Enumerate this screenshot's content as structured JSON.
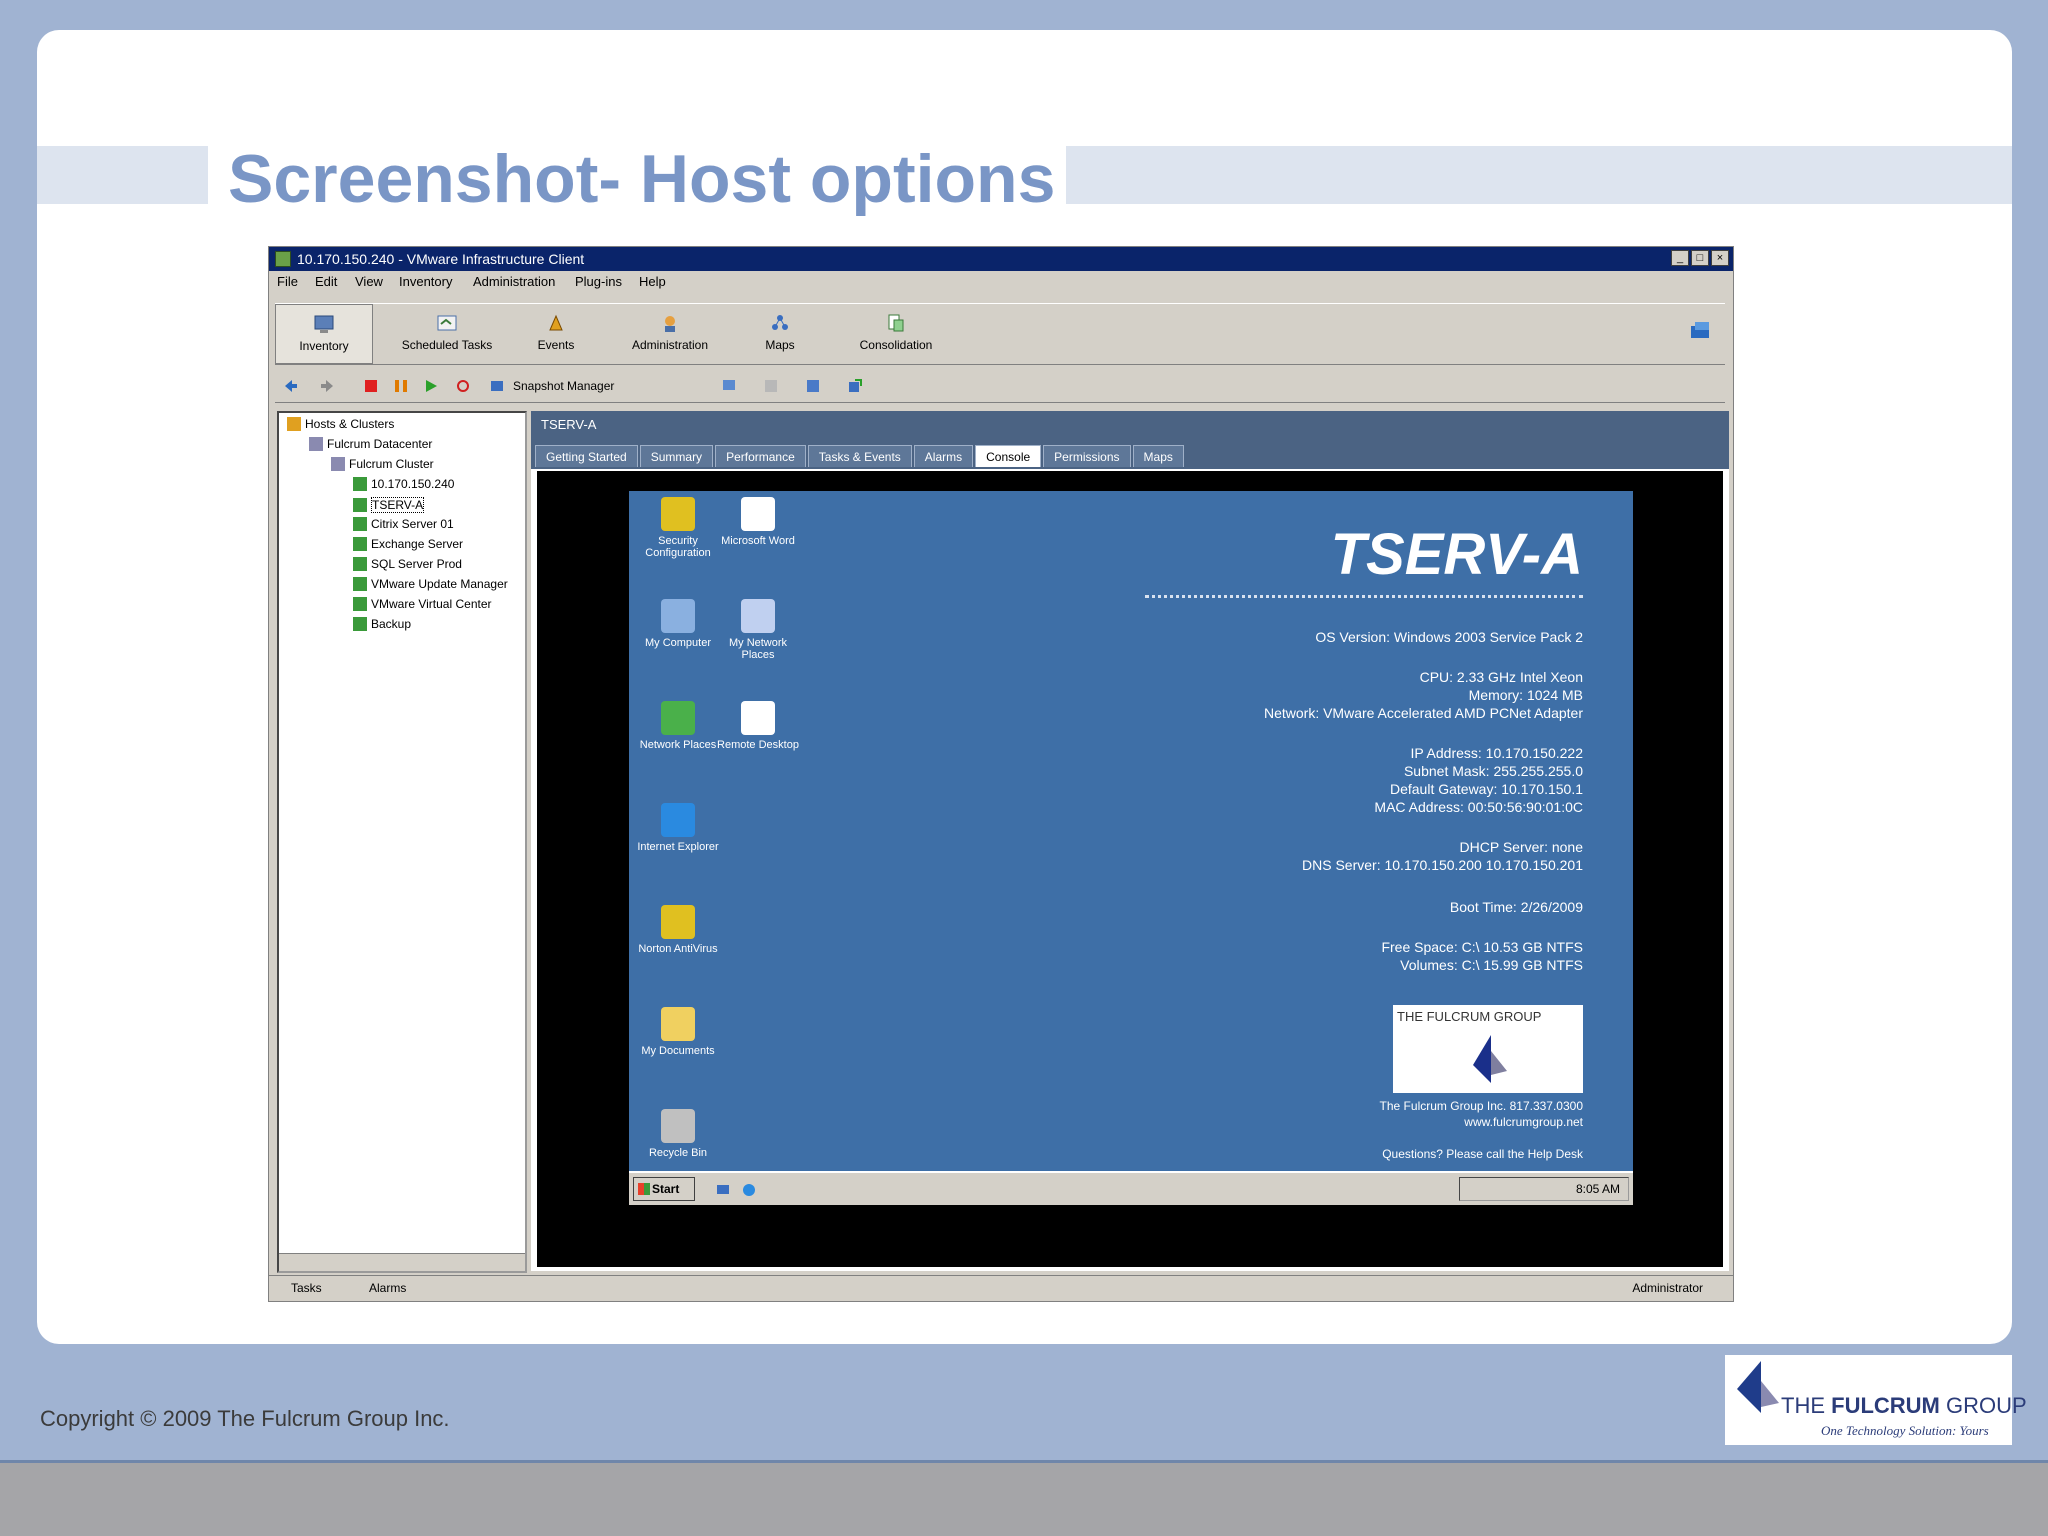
{
  "slide": {
    "title": "Screenshot- Host options",
    "copyright": "Copyright © 2009 The Fulcrum Group Inc.",
    "logo": {
      "prefix": "THE ",
      "bold": "FULCRUM",
      "suffix": " GROUP",
      "tagline": "One Technology Solution: Yours"
    }
  },
  "window": {
    "title": "10.170.150.240 - VMware Infrastructure Client",
    "menu": [
      "File",
      "Edit",
      "View",
      "Inventory",
      "Administration",
      "Plug-ins",
      "Help"
    ],
    "toolbar": [
      "Inventory",
      "Scheduled Tasks",
      "Events",
      "Administration",
      "Maps",
      "Consolidation"
    ],
    "toolbar2": {
      "snapshot_label": "Snapshot Manager"
    },
    "tree": [
      {
        "label": "Hosts & Clusters",
        "indent": 0
      },
      {
        "label": "Fulcrum Datacenter",
        "indent": 1
      },
      {
        "label": "Fulcrum Cluster",
        "indent": 2
      },
      {
        "label": "10.170.150.240",
        "indent": 3
      },
      {
        "label": "TSERV-A",
        "indent": 3
      },
      {
        "label": "Citrix Server 01",
        "indent": 3
      },
      {
        "label": "Exchange Server",
        "indent": 3
      },
      {
        "label": "SQL Server Prod",
        "indent": 3
      },
      {
        "label": "VMware Update Manager",
        "indent": 3
      },
      {
        "label": "VMware Virtual Center",
        "indent": 3
      },
      {
        "label": "Backup",
        "indent": 3
      }
    ],
    "status": {
      "tasks": "Tasks",
      "alarms": "Alarms",
      "user": "Administrator"
    }
  },
  "panel": {
    "host": "TSERV-A",
    "tabs": [
      {
        "label": "Getting Started",
        "active": false
      },
      {
        "label": "Summary",
        "active": false
      },
      {
        "label": "Performance",
        "active": false
      },
      {
        "label": "Tasks & Events",
        "active": false
      },
      {
        "label": "Alarms",
        "active": false
      },
      {
        "label": "Console",
        "active": true
      },
      {
        "label": "Permissions",
        "active": false
      },
      {
        "label": "Maps",
        "active": false
      }
    ]
  },
  "guest": {
    "hostname": "TSERV-A",
    "icons": [
      "Security Configuration",
      "Microsoft Word",
      "My Computer",
      "My Network Places",
      "Network Places",
      "Remote Desktop",
      "Internet Explorer",
      "Norton AntiVirus",
      "My Documents",
      "Recycle Bin"
    ],
    "bginfo": [
      "OS Version: Windows 2003 Service Pack 2",
      "CPU: 2.33 GHz Intel Xeon",
      "Memory: 1024 MB",
      "Network: VMware Accelerated AMD PCNet Adapter",
      "IP Address: 10.170.150.222",
      "Subnet Mask: 255.255.255.0",
      "Default Gateway: 10.170.150.1",
      "MAC Address: 00:50:56:90:01:0C",
      "DHCP Server: none",
      "DNS Server: 10.170.150.200 10.170.150.201",
      "Boot Time: 2/26/2009",
      "Free Space: C:\\ 10.53 GB NTFS",
      "Volumes: C:\\ 15.99 GB NTFS"
    ],
    "bg_logo": "THE FULCRUM GROUP",
    "bg_footer": [
      "The Fulcrum Group Inc. 817.337.0300",
      "www.fulcrumgroup.net",
      "Questions? Please call the Help Desk"
    ],
    "taskbar": {
      "start": "Start",
      "clock": "8:05 AM"
    }
  },
  "colors": {
    "title": "#7a96c6",
    "background": "#a0b3d2",
    "desktop": "#3e6fa7"
  }
}
